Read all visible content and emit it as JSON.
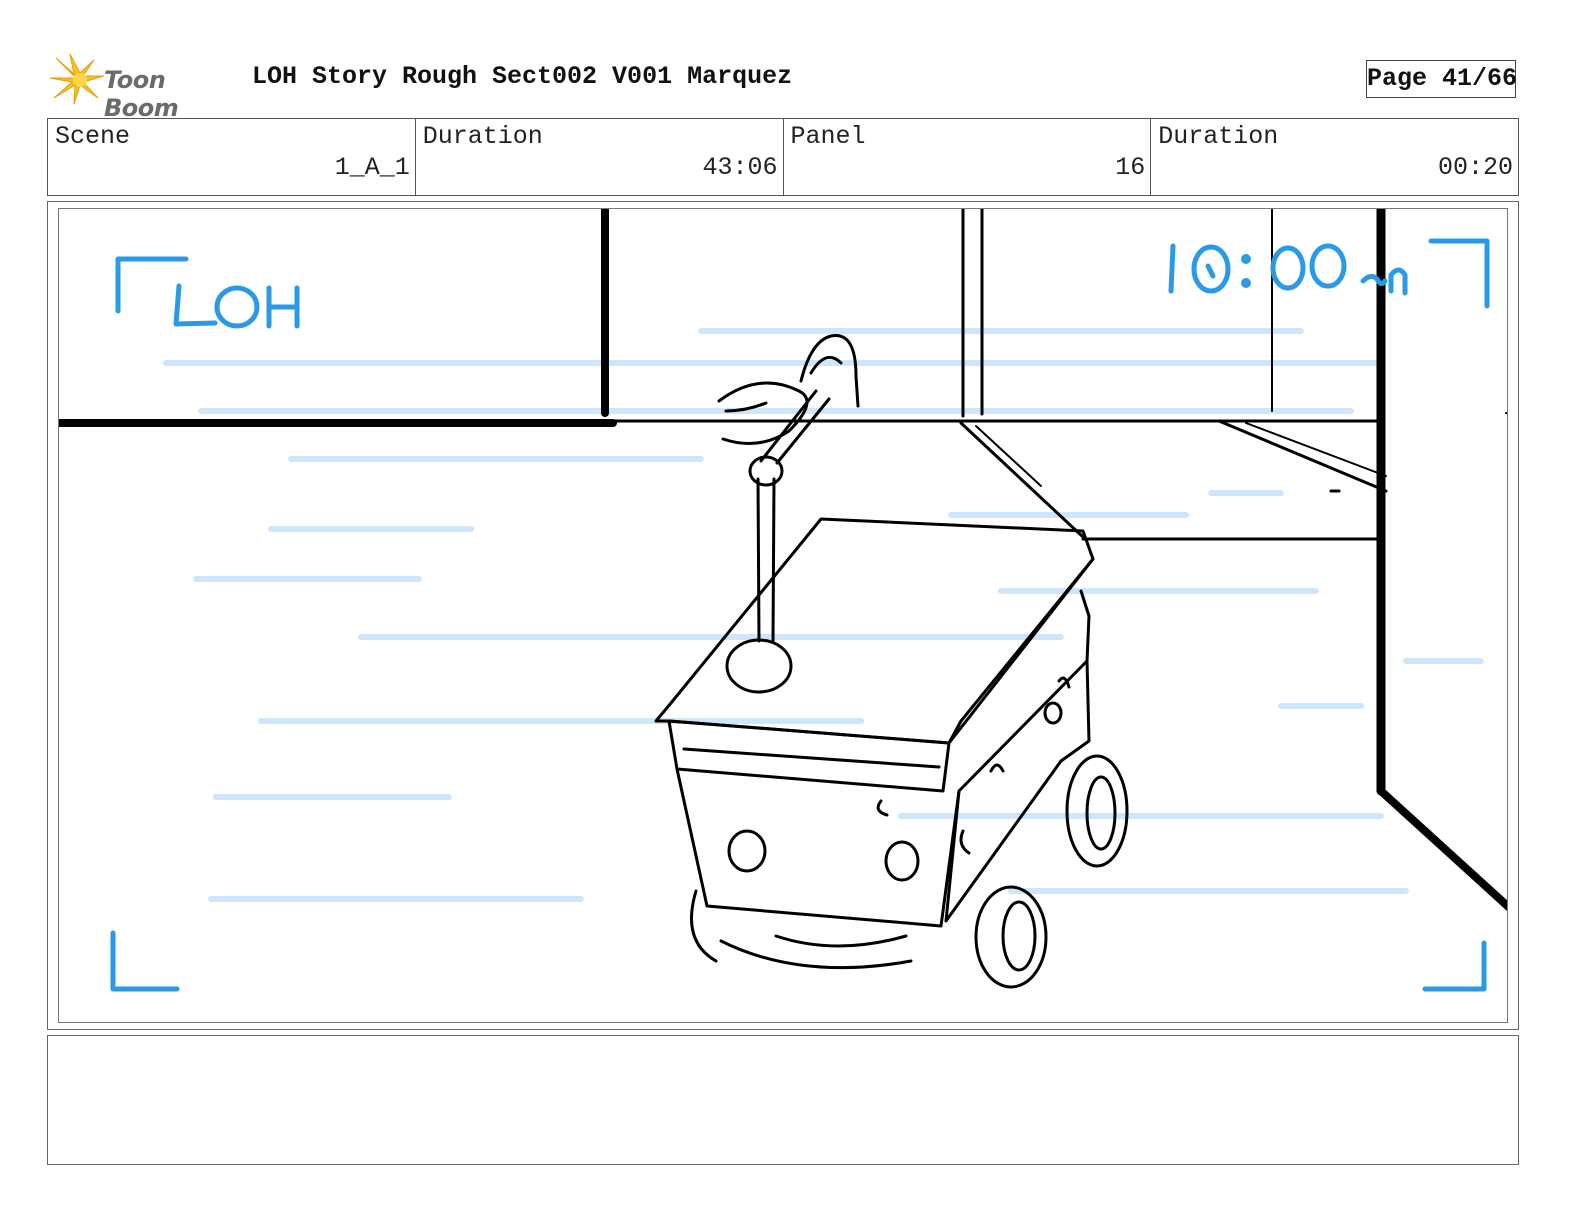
{
  "header": {
    "logo_text": "Toon Boom",
    "title": "LOH Story Rough Sect002 V001 Marquez",
    "page_label": "Page 41/66"
  },
  "info": {
    "scene_label": "Scene",
    "scene_value": "1_A_1",
    "scene_duration_label": "Duration",
    "scene_duration_value": "43:06",
    "panel_label": "Panel",
    "panel_value": "16",
    "panel_duration_label": "Duration",
    "panel_duration_value": "00:20"
  },
  "panel": {
    "handwritten_location": "LOH",
    "handwritten_time": "10:00am",
    "sketch_subject": "delivery-robot",
    "annotation_color": "#2b9ae6",
    "guide_color": "#cfe6fa"
  },
  "notes": {
    "text": ""
  }
}
